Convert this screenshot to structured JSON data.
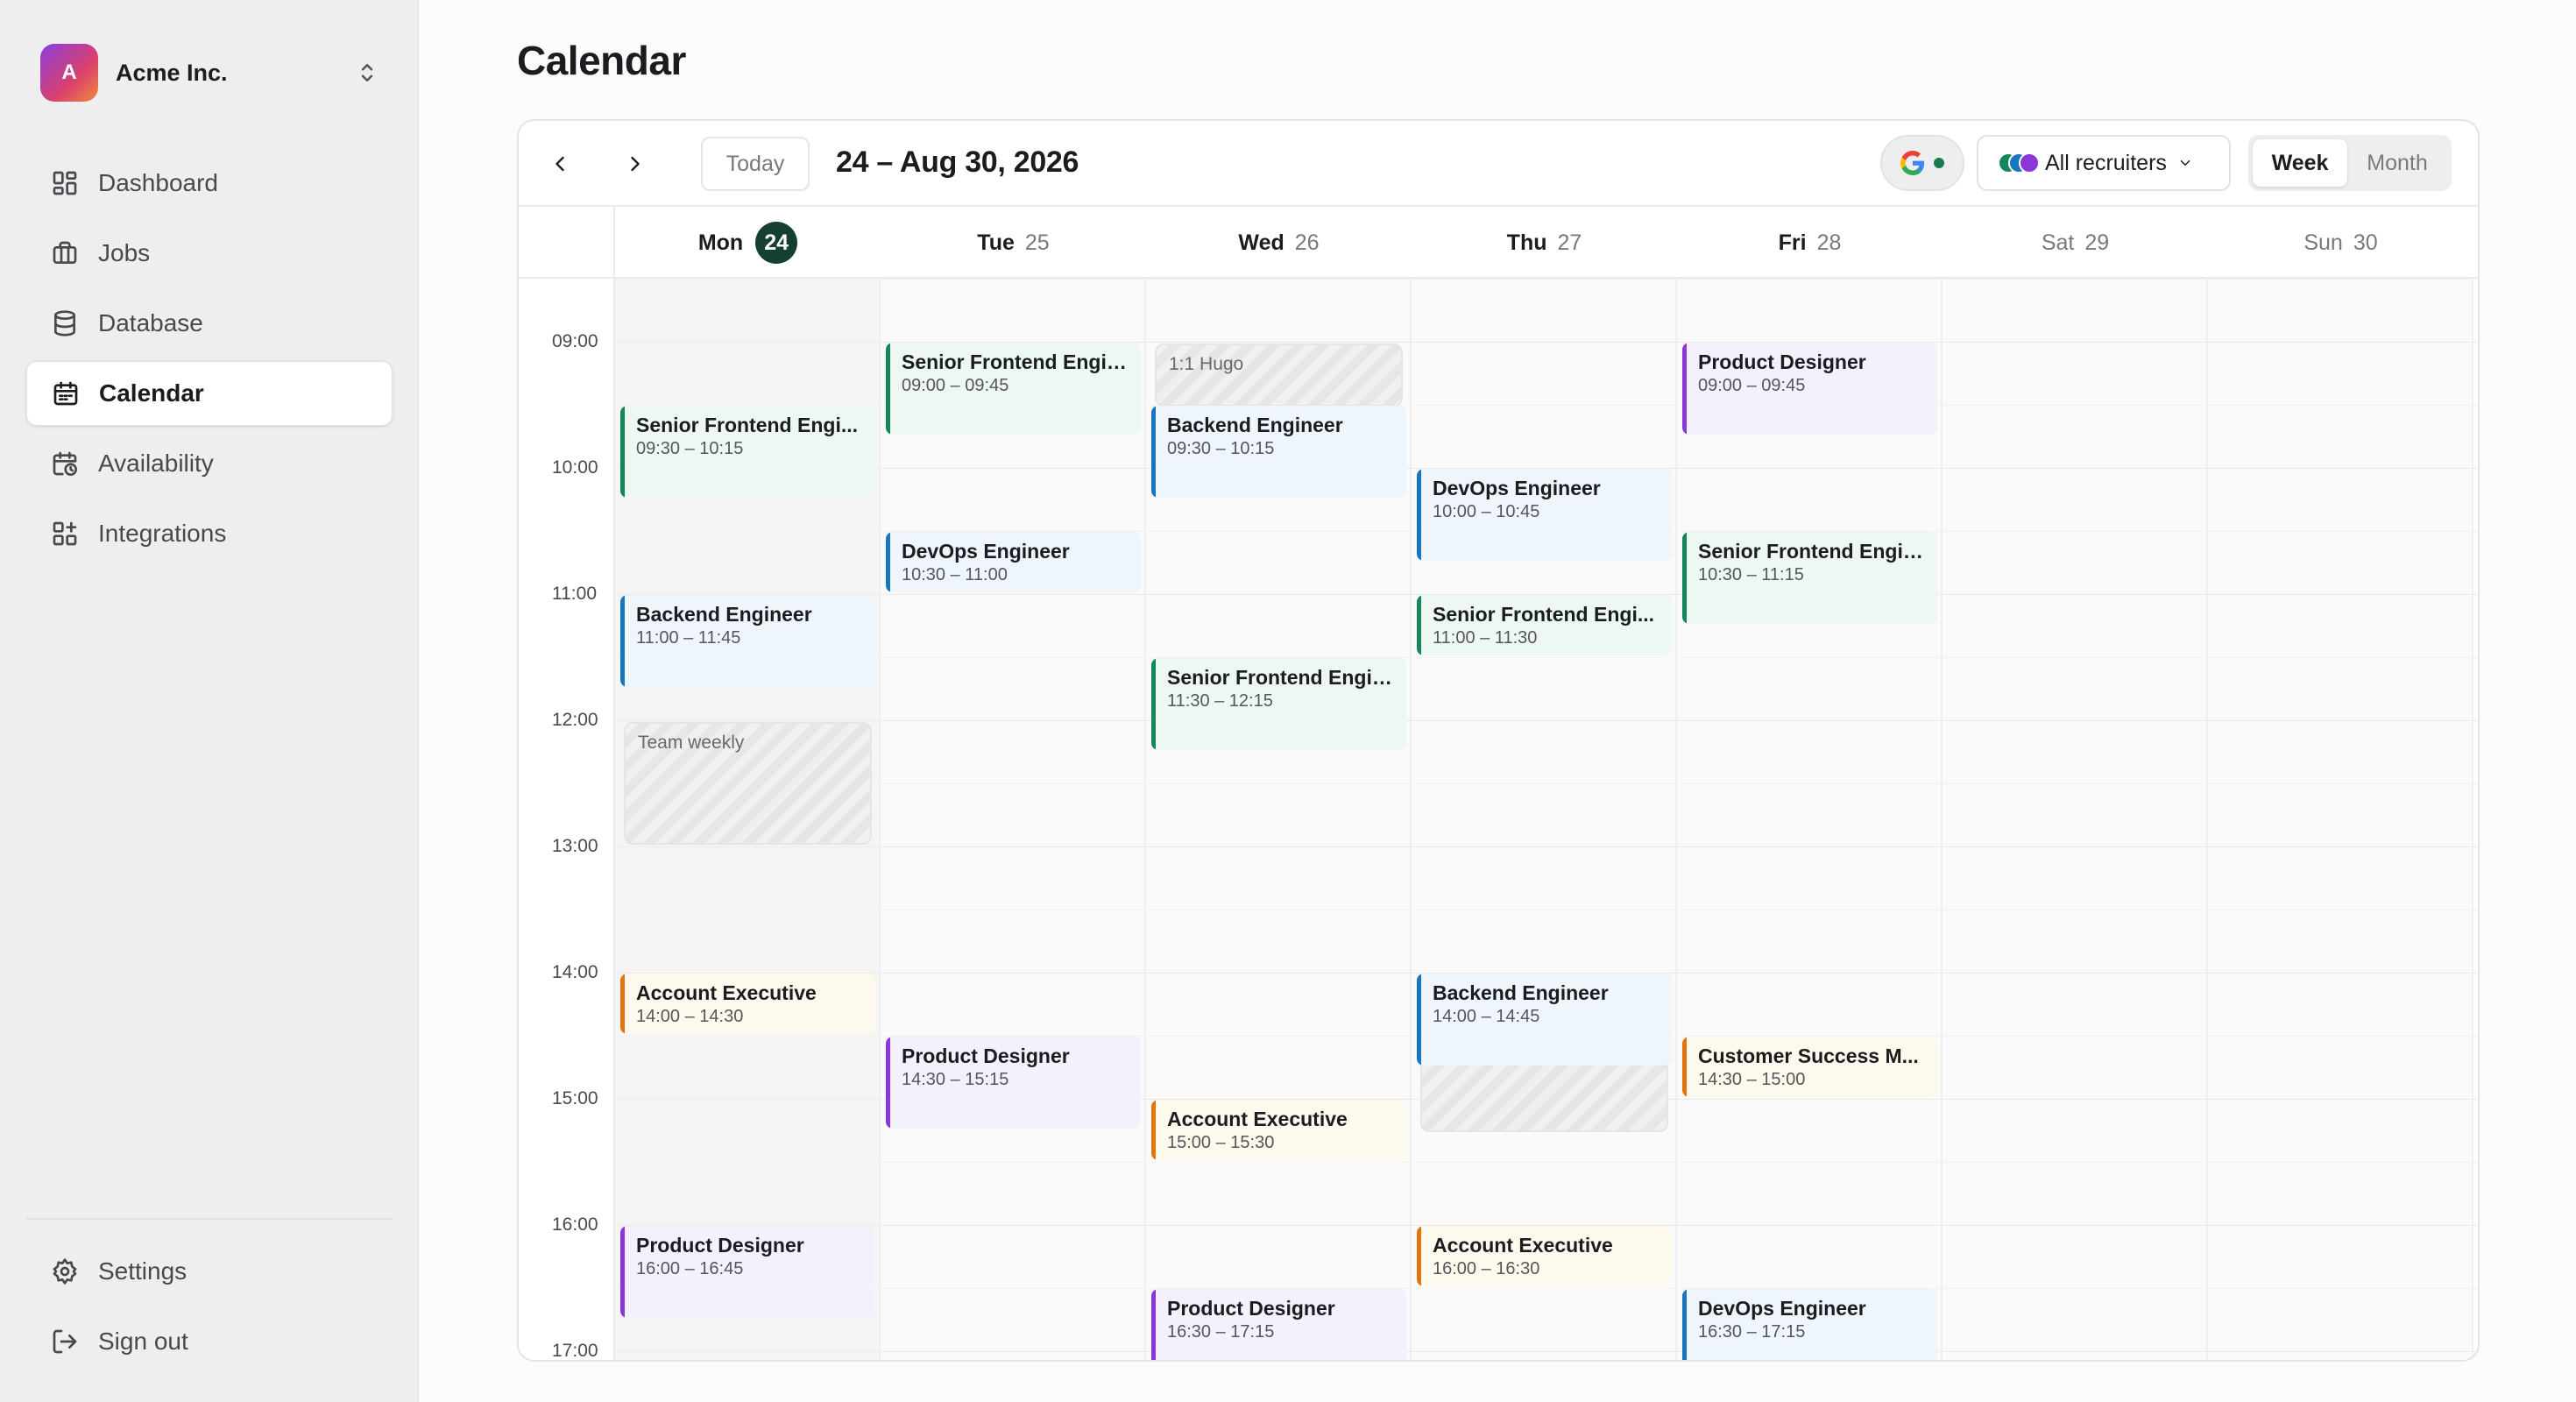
{
  "org": {
    "initial": "A",
    "name": "Acme Inc."
  },
  "nav": {
    "items": [
      {
        "label": "Dashboard",
        "icon": "dashboard-icon"
      },
      {
        "label": "Jobs",
        "icon": "briefcase-icon"
      },
      {
        "label": "Database",
        "icon": "database-icon"
      },
      {
        "label": "Calendar",
        "icon": "calendar-icon",
        "active": true
      },
      {
        "label": "Availability",
        "icon": "calendar-clock-icon"
      },
      {
        "label": "Integrations",
        "icon": "integrations-icon"
      }
    ],
    "bottom": [
      {
        "label": "Settings",
        "icon": "gear-icon"
      },
      {
        "label": "Sign out",
        "icon": "sign-out-icon"
      }
    ]
  },
  "page": {
    "title": "Calendar"
  },
  "toolbar": {
    "today": "Today",
    "range": "24 – Aug 30, 2026",
    "recruiters": "All recruiters",
    "view_week": "Week",
    "view_month": "Month",
    "google_status_color": "#1a7a4f"
  },
  "days": [
    {
      "name": "Mon",
      "num": "24",
      "today": true
    },
    {
      "name": "Tue",
      "num": "25"
    },
    {
      "name": "Wed",
      "num": "26"
    },
    {
      "name": "Thu",
      "num": "27"
    },
    {
      "name": "Fri",
      "num": "28"
    },
    {
      "name": "Sat",
      "num": "29",
      "weekend": true
    },
    {
      "name": "Sun",
      "num": "30",
      "weekend": true
    }
  ],
  "hours": [
    "09:00",
    "10:00",
    "11:00",
    "12:00",
    "13:00",
    "14:00",
    "15:00",
    "16:00",
    "17:00"
  ],
  "colors": {
    "green": "#14875a",
    "blue": "#1677bf",
    "purple": "#8a36d8",
    "orange": "#e0750f",
    "today_badge": "#15402f"
  },
  "events": [
    {
      "day": 0,
      "title": "Senior Frontend Engi...",
      "time": "09:30 – 10:15",
      "color": "green"
    },
    {
      "day": 0,
      "title": "Backend Engineer",
      "time": "11:00 – 11:45",
      "color": "blue"
    },
    {
      "day": 0,
      "title": "Account Executive",
      "time": "14:00 – 14:30",
      "color": "orange"
    },
    {
      "day": 0,
      "title": "Product Designer",
      "time": "16:00 – 16:45",
      "color": "purple"
    },
    {
      "day": 1,
      "title": "Senior Frontend Engin...",
      "time": "09:00 – 09:45",
      "color": "green"
    },
    {
      "day": 1,
      "title": "DevOps Engineer",
      "time": "10:30 – 11:00",
      "color": "blue"
    },
    {
      "day": 1,
      "title": "Product Designer",
      "time": "14:30 – 15:15",
      "color": "purple"
    },
    {
      "day": 2,
      "title": "Backend Engineer",
      "time": "09:30 – 10:15",
      "color": "blue"
    },
    {
      "day": 2,
      "title": "Senior Frontend Engin...",
      "time": "11:30 – 12:15",
      "color": "green"
    },
    {
      "day": 2,
      "title": "Account Executive",
      "time": "15:00 – 15:30",
      "color": "orange"
    },
    {
      "day": 2,
      "title": "Product Designer",
      "time": "16:30 – 17:15",
      "color": "purple"
    },
    {
      "day": 3,
      "title": "DevOps Engineer",
      "time": "10:00 – 10:45",
      "color": "blue"
    },
    {
      "day": 3,
      "title": "Senior Frontend Engi...",
      "time": "11:00 – 11:30",
      "color": "green"
    },
    {
      "day": 3,
      "title": "Backend Engineer",
      "time": "14:00 – 14:45",
      "color": "blue"
    },
    {
      "day": 3,
      "title": "Account Executive",
      "time": "16:00 – 16:30",
      "color": "orange"
    },
    {
      "day": 4,
      "title": "Product Designer",
      "time": "09:00 – 09:45",
      "color": "purple"
    },
    {
      "day": 4,
      "title": "Senior Frontend Engin...",
      "time": "10:30 – 11:15",
      "color": "green"
    },
    {
      "day": 4,
      "title": "Customer Success M...",
      "time": "14:30 – 15:00",
      "color": "orange"
    },
    {
      "day": 4,
      "title": "DevOps Engineer",
      "time": "16:30 – 17:15",
      "color": "blue"
    }
  ],
  "blocks": [
    {
      "day": 0,
      "label": "Team weekly"
    },
    {
      "day": 2,
      "label": "1:1 Hugo"
    },
    {
      "day": 3,
      "label": ""
    }
  ]
}
